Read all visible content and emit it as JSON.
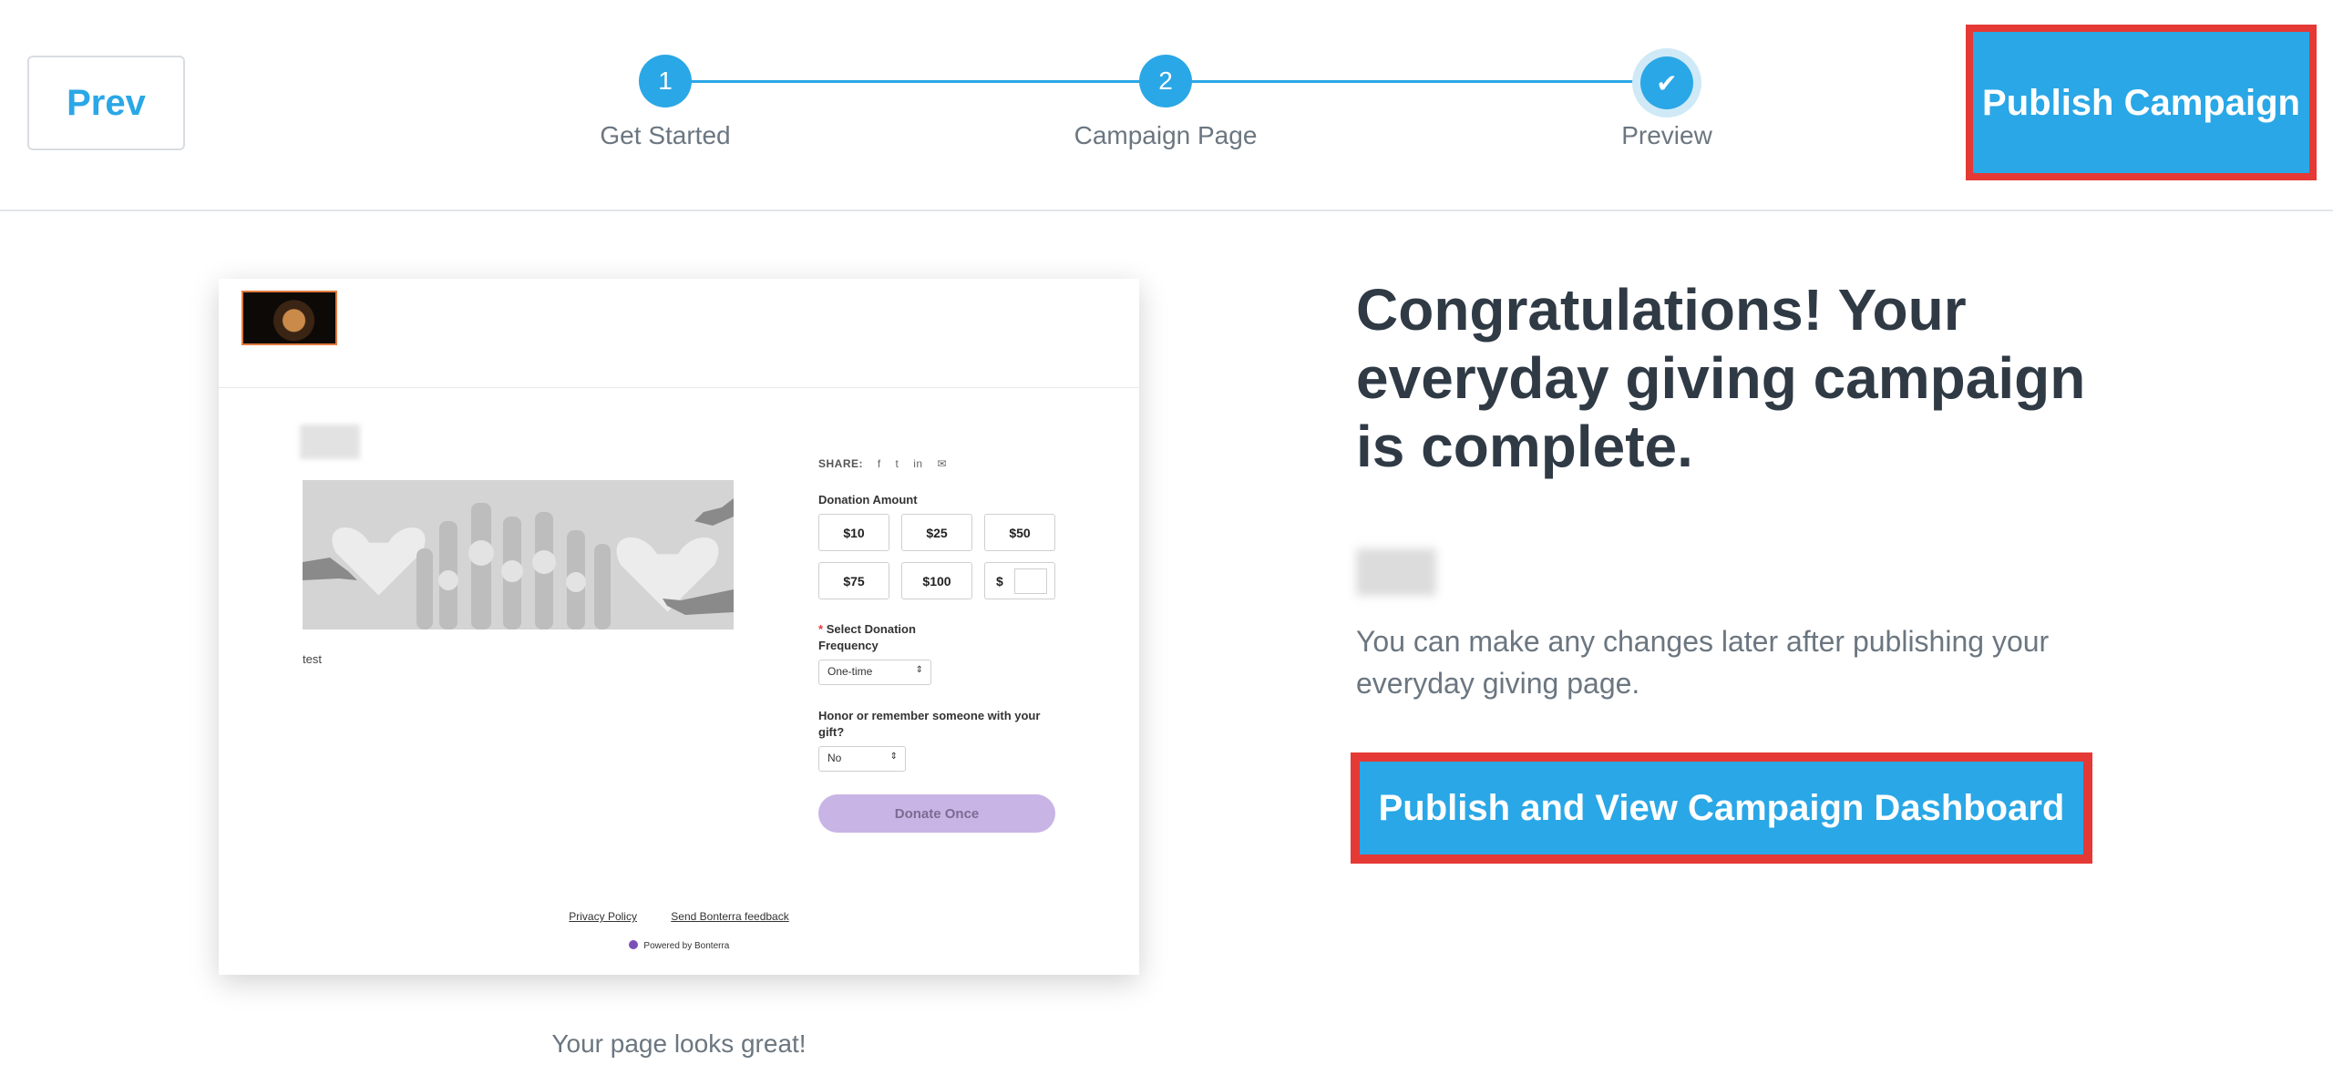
{
  "header": {
    "prev_label": "Prev",
    "publish_label": "Publish Campaign",
    "steps": [
      {
        "number": "1",
        "label": "Get Started"
      },
      {
        "number": "2",
        "label": "Campaign Page"
      },
      {
        "number": "✔",
        "label": "Preview"
      }
    ]
  },
  "preview": {
    "description": "test",
    "share_label": "SHARE:",
    "share_icons": [
      "f",
      "t",
      "in",
      "✉"
    ],
    "donation_amount_label": "Donation Amount",
    "amounts": [
      "$10",
      "$25",
      "$50",
      "$75",
      "$100"
    ],
    "other_amount_prefix": "$",
    "frequency_required_mark": "*",
    "frequency_label": "Select Donation Frequency",
    "frequency_value": "One-time",
    "honor_label": "Honor or remember someone with your gift?",
    "honor_value": "No",
    "donate_button": "Donate Once",
    "privacy_link": "Privacy Policy",
    "feedback_link": "Send Bonterra feedback",
    "powered_by_prefix": "Powered by",
    "powered_by_brand": "Bonterra"
  },
  "main": {
    "looks_great": "Your page looks great!",
    "congrats_heading": "Congratulations! Your everyday giving campaign is complete.",
    "changes_text": "You can make any changes later after publishing your everyday giving page.",
    "publish_dashboard_label": "Publish and View Campaign Dashboard"
  },
  "colors": {
    "accent": "#2aa7e6",
    "highlight_border": "#e53935",
    "donate_button_bg": "#c9b4e6"
  }
}
